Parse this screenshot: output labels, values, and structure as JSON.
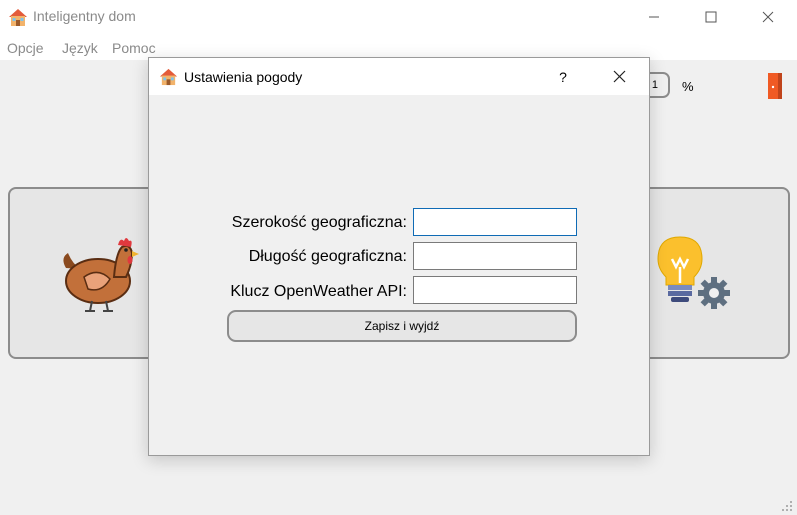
{
  "window": {
    "title": "Inteligentny dom",
    "app_icon": "house-icon"
  },
  "menu": {
    "items": [
      {
        "label": "Opcje"
      },
      {
        "label": "Język"
      },
      {
        "label": "Pomoc"
      }
    ]
  },
  "background": {
    "field_value": "1",
    "percent_label": "%",
    "left_panel_icon": "chicken-icon",
    "right_panel_icon": "lightbulb-gear-icon",
    "exit_icon": "exit-door-icon"
  },
  "dialog": {
    "title": "Ustawienia pogody",
    "help_label": "?",
    "latitude_label": "Szerokość geograficzna:",
    "latitude_value": "",
    "longitude_label": "Długość geograficzna:",
    "longitude_value": "",
    "api_key_label": "Klucz OpenWeather API:",
    "api_key_value": "",
    "save_button_label": "Zapisz i wyjdź"
  },
  "colors": {
    "focus_border": "#0f6bb5",
    "window_bg": "#f0f0f0",
    "exit_accent": "#f05a24"
  }
}
